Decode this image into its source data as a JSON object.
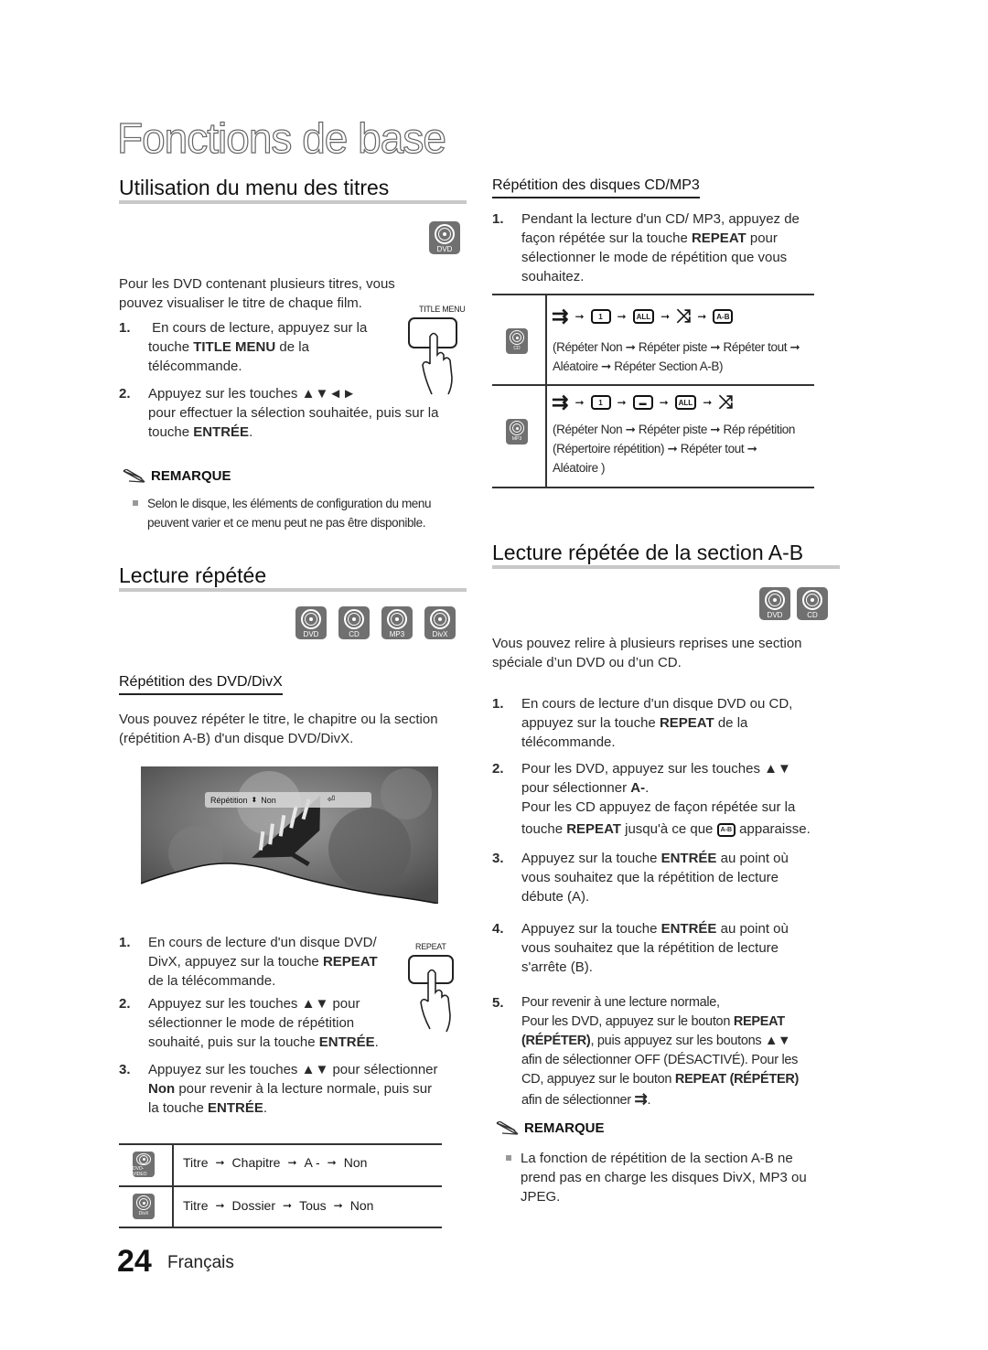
{
  "page": {
    "title": "Fonctions de base",
    "page_number": "24",
    "language": "Français"
  },
  "left": {
    "menu_section": {
      "heading": "Utilisation du menu des titres",
      "disc_badge": "DVD",
      "intro_line1": "Pour les DVD contenant plusieurs titres, vous",
      "intro_line2": "pouvez visualiser le titre de chaque film.",
      "remote_button_label": "TITLE MENU",
      "step1": {
        "num": "1.",
        "text_a": "En cours de lecture, appuyez sur la",
        "text_b_pre": "touche ",
        "text_b_bold": "TITLE MENU",
        "text_b_post": " de la",
        "text_c": "télécommande."
      },
      "step2": {
        "num": "2.",
        "text_a": "Appuyez sur les touches ▲▼◄►",
        "text_b": "pour effectuer la sélection souhaitée, puis sur la",
        "text_c_pre": "touche ",
        "text_c_bold": "ENTRÉE",
        "text_c_post": "."
      },
      "remark_title": "REMARQUE",
      "remark_line1": "Selon le disque, les éléments de configuration du menu",
      "remark_line2": "peuvent varier et ce menu peut ne pas être disponible."
    },
    "repeat_section": {
      "heading": "Lecture répétée",
      "disc_badges": [
        "DVD",
        "CD",
        "MP3",
        "DivX"
      ],
      "subheading": "Répétition des DVD/DivX",
      "intro_line1": "Vous pouvez répéter le titre, le chapitre ou la section",
      "intro_line2": "(répétition A-B) d'un disque DVD/DivX.",
      "osd": {
        "label": "Répétition",
        "value": "Non"
      },
      "remote_button_label": "REPEAT",
      "step1": {
        "num": "1.",
        "text_a": "En cours de lecture d'un disque DVD/",
        "text_b_pre": "DivX, appuyez sur la touche ",
        "text_b_bold": "REPEAT",
        "text_c": "de la télécommande."
      },
      "step2": {
        "num": "2.",
        "text_a": "Appuyez sur les touches ▲▼ pour",
        "text_b": "sélectionner le mode de répétition",
        "text_c_pre": "souhaité, puis sur la touche ",
        "text_c_bold": "ENTRÉE",
        "text_c_post": "."
      },
      "step3": {
        "num": "3.",
        "text_a": "Appuyez sur les touches ▲▼ pour sélectionner",
        "text_b_bold": "Non",
        "text_b_post": " pour revenir à la lecture normale, puis sur",
        "text_c_pre": "la touche ",
        "text_c_bold": "ENTRÉE",
        "text_c_post": "."
      },
      "table": [
        {
          "badge": "DVD-VIDEO",
          "sequence": [
            "Titre",
            "Chapitre",
            "A -",
            "Non"
          ]
        },
        {
          "badge": "DivX",
          "sequence": [
            "Titre",
            "Dossier",
            "Tous",
            "Non"
          ]
        }
      ],
      "arrow": "➞"
    }
  },
  "right": {
    "cd_section": {
      "subheading": "Répétition des disques CD/MP3",
      "step1": {
        "num": "1.",
        "text_a": "Pendant la lecture d'un CD/ MP3, appuyez de",
        "text_b_pre": "façon répétée sur la touche ",
        "text_b_bold": "REPEAT",
        "text_b_post": " pour",
        "text_c": "sélectionner le mode de répétition que vous",
        "text_d": "souhaitez."
      },
      "table": [
        {
          "badge": "CD",
          "icons": [
            "repeat-off",
            "repeat-track",
            "repeat-all",
            "shuffle",
            "repeat-ab"
          ],
          "icon_labels": [
            "",
            "1",
            "ALL",
            "",
            "A-B"
          ],
          "desc_line1": "(Répéter Non ➞ Répéter piste  ➞ Répéter tout  ➞",
          "desc_line2": "Aléatoire  ➞ Répéter Section A-B)"
        },
        {
          "badge": "MP3",
          "icons": [
            "repeat-off",
            "repeat-track",
            "repeat-folder",
            "repeat-all",
            "shuffle"
          ],
          "icon_labels": [
            "",
            "1",
            "▬",
            "ALL",
            ""
          ],
          "desc_line1": "(Répéter Non ➞ Répéter piste ➞ Rép répétition",
          "desc_line2": "(Répertoire répétition) ➞ Répéter tout ➞",
          "desc_line3": "Aléatoire )"
        }
      ]
    },
    "ab_section": {
      "heading": "Lecture répétée de la section A-B",
      "disc_badges": [
        "DVD",
        "CD"
      ],
      "intro_line1": "Vous pouvez relire à plusieurs reprises une section",
      "intro_line2": "spéciale d’un DVD ou d’un CD.",
      "step1": {
        "num": "1.",
        "text_a": "En cours de lecture d'un disque DVD ou CD,",
        "text_b_pre": "appuyez sur la touche ",
        "text_b_bold": "REPEAT",
        "text_b_post": " de la",
        "text_c": "télécommande."
      },
      "step2": {
        "num": "2.",
        "text_a": "Pour les DVD, appuyez sur les touches ▲▼",
        "text_b_pre": "pour sélectionner ",
        "text_b_bold": "A-",
        "text_b_post": ".",
        "text_c": "Pour les CD appuyez de façon répétée sur la",
        "text_d_pre": "touche ",
        "text_d_bold": "REPEAT",
        "text_d_mid": " jusqu'à ce que ",
        "text_d_icon": "A-B",
        "text_d_post": " apparaisse."
      },
      "step3": {
        "num": "3.",
        "text_a_pre": "Appuyez sur la touche ",
        "text_a_bold": "ENTRÉE",
        "text_a_post": " au point où",
        "text_b": "vous souhaitez que la répétition de lecture",
        "text_c": "débute (A)."
      },
      "step4": {
        "num": "4.",
        "text_a_pre": "Appuyez sur la touche ",
        "text_a_bold": "ENTRÉE",
        "text_a_post": " au point où",
        "text_b": "vous souhaitez que la répétition de lecture",
        "text_c": "s'arrête (B)."
      },
      "step5": {
        "num": "5.",
        "text_a": "Pour revenir à une lecture normale,",
        "text_b_pre": "Pour les DVD, appuyez sur le bouton ",
        "text_b_bold": "REPEAT",
        "text_c_bold": "(RÉPÉTER)",
        "text_c_post": ", puis appuyez sur les boutons ▲▼",
        "text_d": "afin de sélectionner OFF (DÉSACTIVÉ). Pour les",
        "text_e_pre": "CD, appuyez sur le bouton ",
        "text_e_bold": "REPEAT (RÉPÉTER)",
        "text_f_pre": "afin de sélectionner ",
        "text_f_post": "."
      },
      "remark_title": "REMARQUE",
      "remark_line1": "La fonction de répétition de la section A-B ne",
      "remark_line2": "prend pas en charge les disques DivX, MP3 ou",
      "remark_line3": "JPEG."
    }
  }
}
